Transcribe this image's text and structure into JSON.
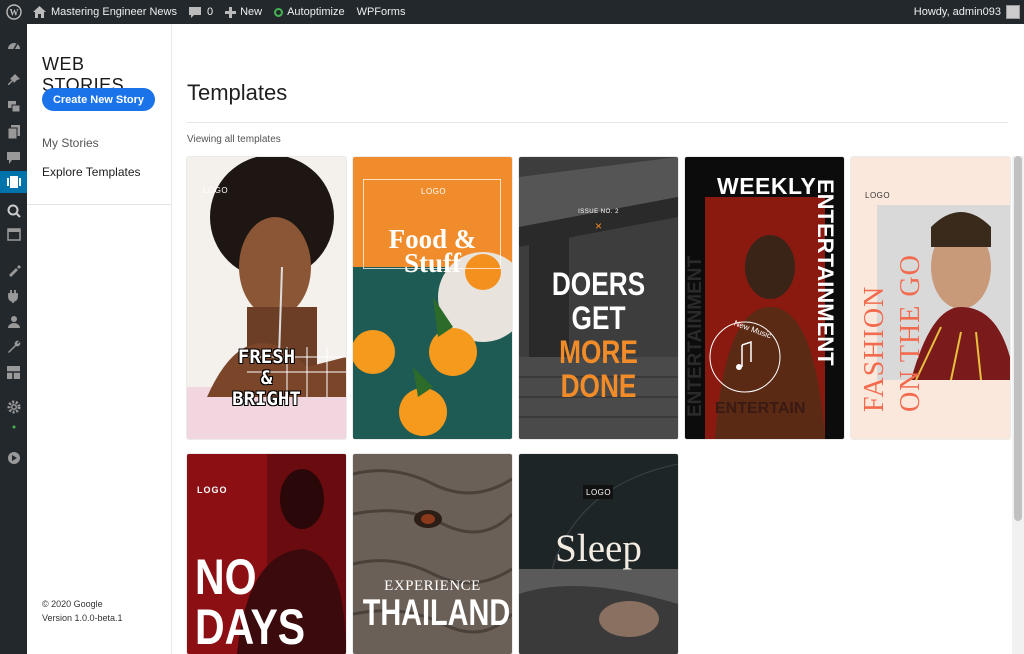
{
  "admin_bar": {
    "site_name": "Mastering Engineer News",
    "comments_count": "0",
    "new_label": "New",
    "autoptimize_label": "Autoptimize",
    "wpforms_label": "WPForms",
    "greeting": "Howdy, admin093"
  },
  "sidebar": {
    "brand": "WEB STORIES",
    "create_button": "Create New Story",
    "nav": [
      {
        "label": "My Stories"
      },
      {
        "label": "Explore Templates"
      }
    ],
    "copyright": "© 2020 Google",
    "version": "Version 1.0.0-beta.1"
  },
  "main": {
    "title": "Templates",
    "subtitle": "Viewing all templates"
  },
  "templates": [
    {
      "logo": "LOGO",
      "line1": "FRESH",
      "line2": "&",
      "line3": "BRIGHT"
    },
    {
      "logo": "LOGO",
      "line1": "Food &",
      "line2": "Stuff"
    },
    {
      "issue": "ISSUE NO. 2",
      "mark": "×",
      "line1": "DOERS",
      "line2a": "GET",
      "line2b": "MORE",
      "line3": "DONE"
    },
    {
      "top": "WEEKLY",
      "side": "ENTERTAINMENT",
      "side2": "ENTERTAINMENT",
      "badge": "New Music",
      "bottom": "ENTERTAIN"
    },
    {
      "logo": "LOGO",
      "side1": "FASHION",
      "side2": "ON THE GO"
    },
    {
      "logo": "LOGO",
      "line1": "NO",
      "line2": "DAYS"
    },
    {
      "line1": "EXPERIENCE",
      "line2": "THAILAND"
    },
    {
      "logo": "LOGO",
      "line1": "Sleep"
    }
  ],
  "colors": {
    "admin_bg": "#23282d",
    "accent_blue": "#1a73e8",
    "wp_active": "#0073aa",
    "orange": "#f28c28",
    "red": "#c4161c"
  }
}
